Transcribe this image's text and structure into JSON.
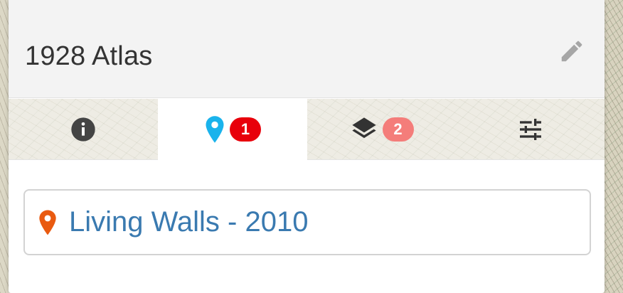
{
  "header": {
    "title": "1928 Atlas",
    "edit_icon": "pencil-icon"
  },
  "tabs": [
    {
      "name": "info",
      "icon": "info-icon",
      "badge": null,
      "active": false
    },
    {
      "name": "places",
      "icon": "map-marker-icon",
      "badge": "1",
      "badge_color": "#e8000b",
      "icon_color": "#1ab3ec",
      "active": true
    },
    {
      "name": "layers",
      "icon": "layers-icon",
      "badge": "2",
      "badge_color": "#f47d7a",
      "active": false
    },
    {
      "name": "settings",
      "icon": "sliders-icon",
      "badge": null,
      "active": false
    }
  ],
  "places": [
    {
      "name": "Living Walls - 2010",
      "icon": "map-marker-icon",
      "icon_color": "#e95a10"
    }
  ],
  "colors": {
    "header_bg": "#f3f3f3",
    "link": "#3a7ab0",
    "icon_dark": "#444444"
  }
}
